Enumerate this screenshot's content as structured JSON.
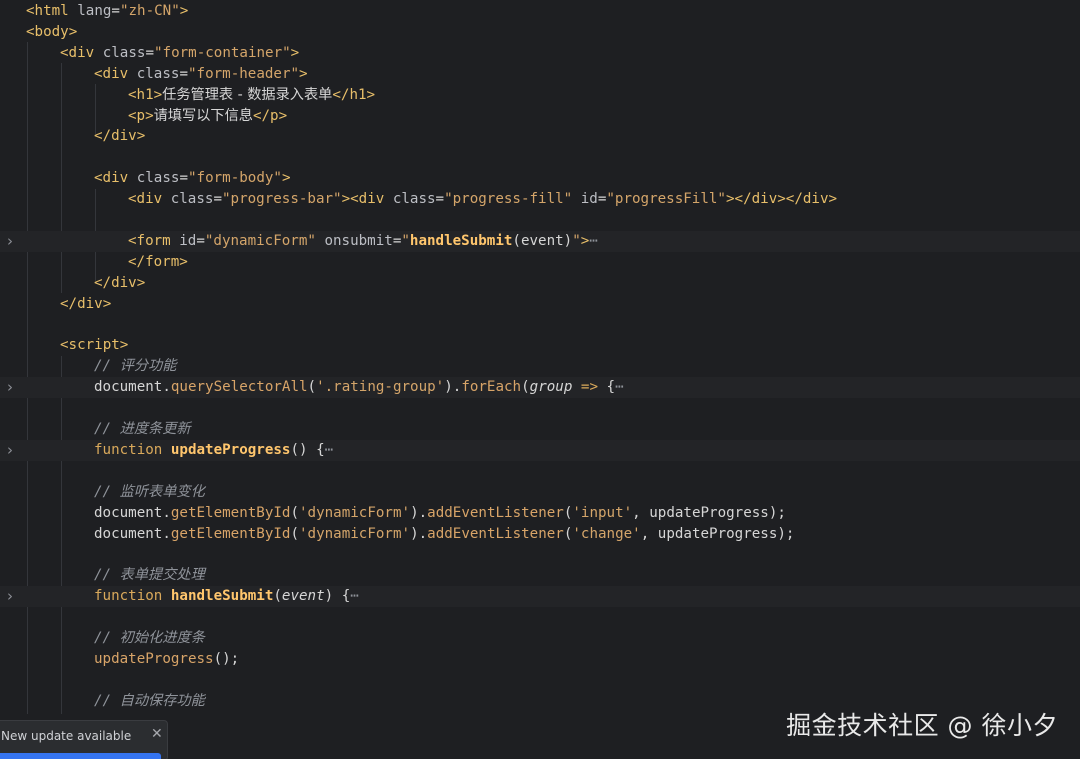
{
  "editor": {
    "lines": [
      {
        "tokens": [
          [
            "c-tag",
            "<html "
          ],
          [
            "c-name",
            "lang"
          ],
          [
            "c-plain",
            "="
          ],
          [
            "c-str",
            "\"zh-CN\""
          ],
          [
            "c-tag",
            ">"
          ]
        ]
      },
      {
        "tokens": [
          [
            "c-tag",
            "<body>"
          ]
        ]
      },
      {
        "tokens": [
          [
            "c-tag",
            "<div "
          ],
          [
            "c-name",
            "class"
          ],
          [
            "c-plain",
            "="
          ],
          [
            "c-str",
            "\"form-container\""
          ],
          [
            "c-tag",
            ">"
          ]
        ]
      },
      {
        "tokens": [
          [
            "c-tag",
            "<div "
          ],
          [
            "c-name",
            "class"
          ],
          [
            "c-plain",
            "="
          ],
          [
            "c-str",
            "\"form-header\""
          ],
          [
            "c-tag",
            ">"
          ]
        ]
      },
      {
        "tokens": [
          [
            "c-tag",
            "<h1>"
          ],
          [
            "c-cn",
            "任务管理表 - 数据录入表单"
          ],
          [
            "c-tag",
            "</h1>"
          ]
        ]
      },
      {
        "tokens": [
          [
            "c-tag",
            "<p>"
          ],
          [
            "c-cn",
            "请填写以下信息"
          ],
          [
            "c-tag",
            "</p>"
          ]
        ]
      },
      {
        "tokens": [
          [
            "c-tag",
            "</div>"
          ]
        ]
      },
      {
        "tokens": []
      },
      {
        "tokens": [
          [
            "c-tag",
            "<div "
          ],
          [
            "c-name",
            "class"
          ],
          [
            "c-plain",
            "="
          ],
          [
            "c-str",
            "\"form-body\""
          ],
          [
            "c-tag",
            ">"
          ]
        ]
      },
      {
        "tokens": [
          [
            "c-tag",
            "<div "
          ],
          [
            "c-name",
            "class"
          ],
          [
            "c-plain",
            "="
          ],
          [
            "c-str",
            "\"progress-bar\""
          ],
          [
            "c-tag",
            "><div "
          ],
          [
            "c-name",
            "class"
          ],
          [
            "c-plain",
            "="
          ],
          [
            "c-str",
            "\"progress-fill\""
          ],
          [
            "c-name",
            " id"
          ],
          [
            "c-plain",
            "="
          ],
          [
            "c-str",
            "\"progressFill\""
          ],
          [
            "c-tag",
            "></div></div>"
          ]
        ]
      },
      {
        "tokens": []
      },
      {
        "tokens": [
          [
            "c-tag",
            "<form "
          ],
          [
            "c-name",
            "id"
          ],
          [
            "c-plain",
            "="
          ],
          [
            "c-str",
            "\"dynamicForm\""
          ],
          [
            "c-name",
            " onsubmit"
          ],
          [
            "c-plain",
            "="
          ],
          [
            "c-str",
            "\""
          ],
          [
            "c-def",
            "handleSubmit"
          ],
          [
            "c-plain",
            "(event)"
          ],
          [
            "c-str",
            "\""
          ],
          [
            "c-tag",
            ">"
          ],
          [
            "c-cmt",
            "⋯"
          ]
        ]
      },
      {
        "tokens": [
          [
            "c-tag",
            "</form>"
          ]
        ]
      },
      {
        "tokens": [
          [
            "c-tag",
            "</div>"
          ]
        ]
      },
      {
        "tokens": [
          [
            "c-tag",
            "</div>"
          ]
        ]
      },
      {
        "tokens": []
      },
      {
        "tokens": [
          [
            "c-tag",
            "<script>"
          ]
        ]
      },
      {
        "tokens": [
          [
            "c-cmt",
            "// "
          ],
          [
            "c-cmtcn",
            "评分功能"
          ]
        ]
      },
      {
        "tokens": [
          [
            "c-plain",
            "document."
          ],
          [
            "c-meth",
            "querySelectorAll"
          ],
          [
            "c-plain",
            "("
          ],
          [
            "c-str",
            "'.rating-group'"
          ],
          [
            "c-plain",
            ")."
          ],
          [
            "c-meth",
            "forEach"
          ],
          [
            "c-plain",
            "("
          ],
          [
            "c-it",
            "group"
          ],
          [
            "c-plain",
            " "
          ],
          [
            "c-kw",
            "=>"
          ],
          [
            "c-plain",
            " {"
          ],
          [
            "c-cmt",
            "⋯"
          ]
        ]
      },
      {
        "tokens": []
      },
      {
        "tokens": [
          [
            "c-cmt",
            "// "
          ],
          [
            "c-cmtcn",
            "进度条更新"
          ]
        ]
      },
      {
        "tokens": [
          [
            "c-kw",
            "function "
          ],
          [
            "c-def",
            "updateProgress"
          ],
          [
            "c-plain",
            "() {"
          ],
          [
            "c-cmt",
            "⋯"
          ]
        ]
      },
      {
        "tokens": []
      },
      {
        "tokens": [
          [
            "c-cmt",
            "// "
          ],
          [
            "c-cmtcn",
            "监听表单变化"
          ]
        ]
      },
      {
        "tokens": [
          [
            "c-plain",
            "document."
          ],
          [
            "c-meth",
            "getElementById"
          ],
          [
            "c-plain",
            "("
          ],
          [
            "c-str",
            "'dynamicForm'"
          ],
          [
            "c-plain",
            ")."
          ],
          [
            "c-meth",
            "addEventListener"
          ],
          [
            "c-plain",
            "("
          ],
          [
            "c-str",
            "'input'"
          ],
          [
            "c-plain",
            ", updateProgress);"
          ]
        ]
      },
      {
        "tokens": [
          [
            "c-plain",
            "document."
          ],
          [
            "c-meth",
            "getElementById"
          ],
          [
            "c-plain",
            "("
          ],
          [
            "c-str",
            "'dynamicForm'"
          ],
          [
            "c-plain",
            ")."
          ],
          [
            "c-meth",
            "addEventListener"
          ],
          [
            "c-plain",
            "("
          ],
          [
            "c-str",
            "'change'"
          ],
          [
            "c-plain",
            ", updateProgress);"
          ]
        ]
      },
      {
        "tokens": []
      },
      {
        "tokens": [
          [
            "c-cmt",
            "// "
          ],
          [
            "c-cmtcn",
            "表单提交处理"
          ]
        ]
      },
      {
        "tokens": [
          [
            "c-kw",
            "function "
          ],
          [
            "c-def",
            "handleSubmit"
          ],
          [
            "c-plain",
            "("
          ],
          [
            "c-it",
            "event"
          ],
          [
            "c-plain",
            ") {"
          ],
          [
            "c-cmt",
            "⋯"
          ]
        ]
      },
      {
        "tokens": []
      },
      {
        "tokens": [
          [
            "c-cmt",
            "// "
          ],
          [
            "c-cmtcn",
            "初始化进度条"
          ]
        ]
      },
      {
        "tokens": [
          [
            "c-meth",
            "updateProgress"
          ],
          [
            "c-plain",
            "();"
          ]
        ]
      },
      {
        "tokens": []
      },
      {
        "tokens": [
          [
            "c-cmt",
            "// "
          ],
          [
            "c-cmtcn",
            "自动保存功能"
          ]
        ]
      }
    ]
  },
  "watermark": {
    "text": "掘金技术社区 @ 徐小夕"
  },
  "toast": {
    "message": "New update available",
    "close_glyph": "✕"
  },
  "icons": {
    "fold": "chevron-right-icon"
  }
}
